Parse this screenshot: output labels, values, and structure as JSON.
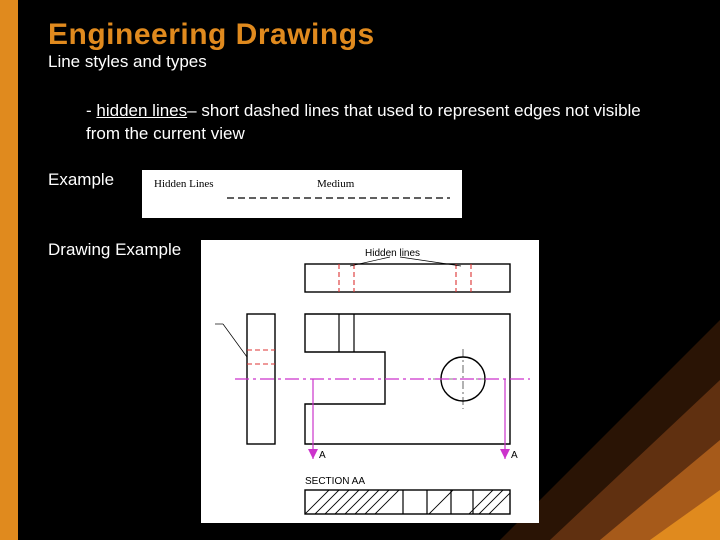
{
  "slide": {
    "title": "Engineering Drawings",
    "subtitle": "Line styles and types",
    "body_prefix": "- ",
    "term": "hidden lines",
    "body_rest": "– short dashed lines that used to represent edges not visible from the current view",
    "example_label": "Example",
    "drawing_label": "Drawing Example",
    "line_sample": {
      "name": "Hidden Lines",
      "weight": "Medium"
    },
    "drawing": {
      "annotation_hidden": "Hidden lines",
      "section_marker": "A",
      "section_label": "SECTION AA"
    }
  }
}
